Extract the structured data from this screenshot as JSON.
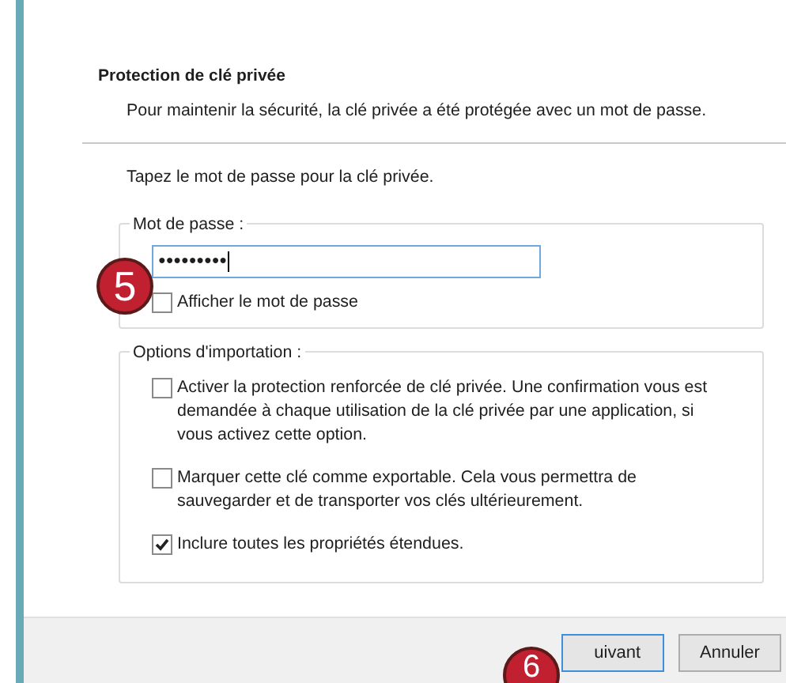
{
  "header": {
    "title": "Protection de clé privée",
    "description": "Pour maintenir la sécurité, la clé privée a été protégée avec un mot de passe."
  },
  "prompt": "Tapez le mot de passe pour la clé privée.",
  "password_group": {
    "legend": "Mot de passe :",
    "value": "●●●●●●●●●",
    "show_password": {
      "label": "Afficher le mot de passe",
      "checked": false
    }
  },
  "options_group": {
    "legend": "Options d'importation :",
    "options": [
      {
        "label": "Activer la protection renforcée de clé privée. Une confirmation vous est demandée à chaque utilisation de la clé privée par une application, si vous activez cette option.",
        "checked": false
      },
      {
        "label": "Marquer cette clé comme exportable. Cela vous permettra de sauvegarder et de transporter vos clés ultérieurement.",
        "checked": false
      },
      {
        "label": "Inclure toutes les propriétés étendues.",
        "checked": true
      }
    ]
  },
  "buttons": [
    {
      "label": "uivant",
      "kind": "default"
    },
    {
      "label": "Annuler",
      "kind": "normal"
    }
  ],
  "callouts": [
    {
      "number": "5"
    },
    {
      "number": "6"
    }
  ]
}
